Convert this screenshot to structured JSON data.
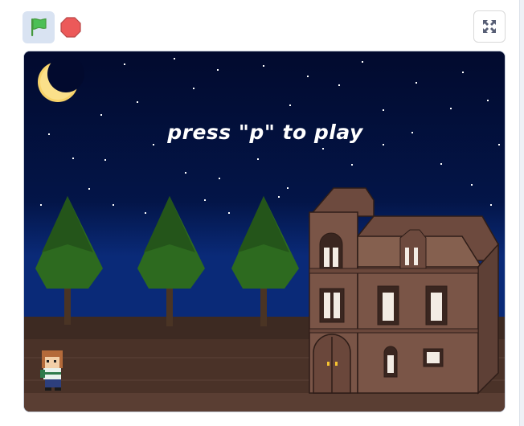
{
  "toolbar": {
    "green_flag_icon": "green-flag-icon",
    "stop_icon": "stop-sign-icon",
    "fullscreen_icon": "fullscreen-icon",
    "flag_color": "#4cbf56",
    "stop_color": "#ec5959"
  },
  "stage": {
    "prompt": "press \"p\" to play",
    "sky_color": "#020a2e",
    "ground_color": "#4a3228",
    "house_color": "#7a5547"
  }
}
